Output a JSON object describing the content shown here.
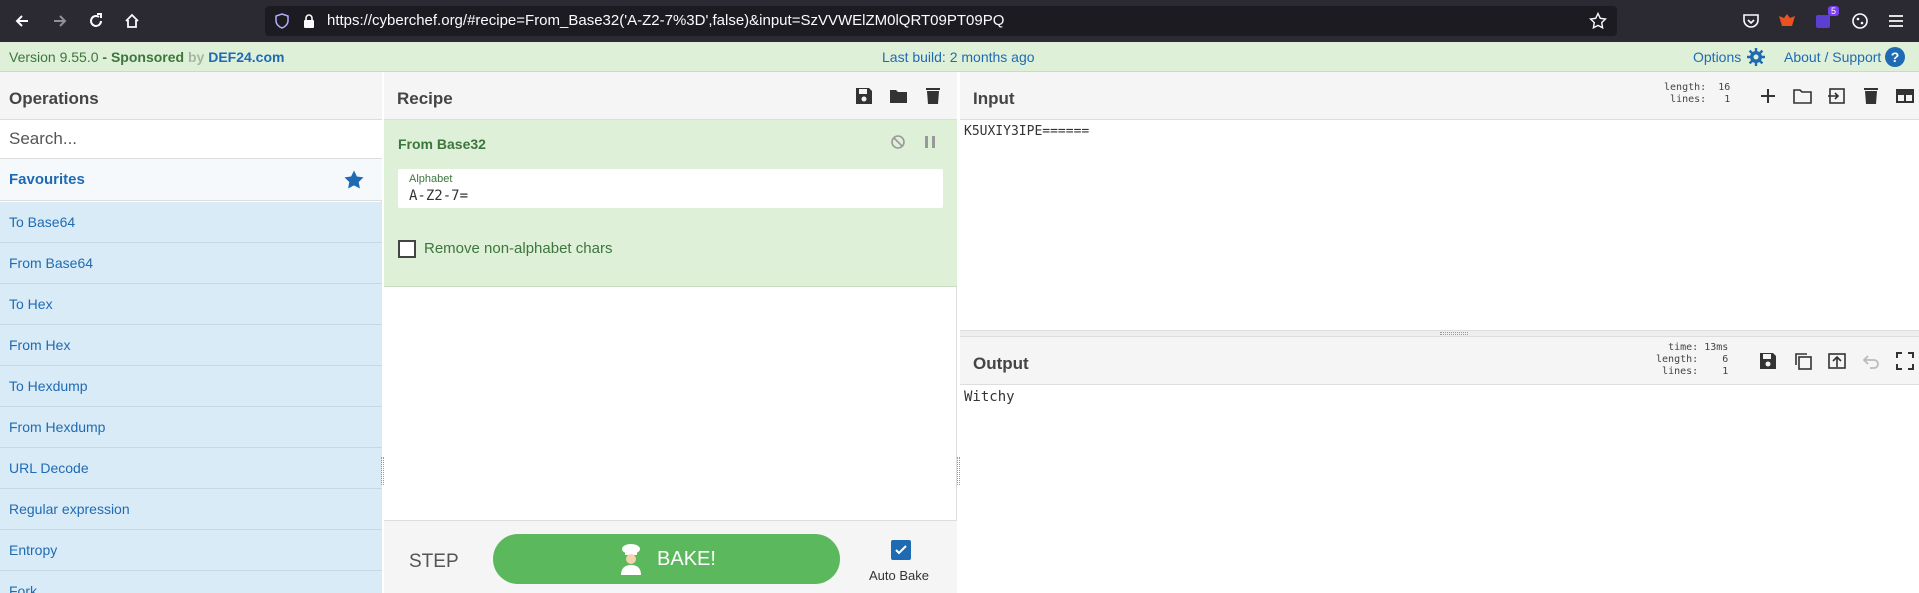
{
  "browser": {
    "url": "https://cyberchef.org/#recipe=From_Base32('A-Z2-7%3D',false)&input=SzVVWElZM0lQRT09PT09PQ",
    "extension_badge": "5"
  },
  "banner": {
    "version": "Version 9.55.0",
    "sponsored_prefix": " - Sponsored",
    "sponsored_by": " by ",
    "sponsor": "DEF24.com",
    "last_build": "Last build: 2 months ago",
    "options": "Options",
    "about": "About / Support",
    "help": "?"
  },
  "operations": {
    "title": "Operations",
    "search_placeholder": "Search...",
    "favourites": "Favourites",
    "items": [
      "To Base64",
      "From Base64",
      "To Hex",
      "From Hex",
      "To Hexdump",
      "From Hexdump",
      "URL Decode",
      "Regular expression",
      "Entropy",
      "Fork"
    ]
  },
  "recipe": {
    "title": "Recipe",
    "op_name": "From Base32",
    "alphabet_label": "Alphabet",
    "alphabet_value": "A-Z2-7=",
    "checkbox_label": "Remove non-alphabet chars",
    "step": "STEP",
    "bake": "BAKE!",
    "auto_bake": "Auto Bake"
  },
  "input": {
    "title": "Input",
    "length_label": "length:",
    "length": "16",
    "lines_label": "lines:",
    "lines": "1",
    "text": "K5UXIY3IPE======"
  },
  "output": {
    "title": "Output",
    "time_label": "time:",
    "time": "13ms",
    "length_label": "length:",
    "length": "6",
    "lines_label": "lines:",
    "lines": "1",
    "text": "Witchy"
  },
  "colors": {
    "accent_blue": "#1f6bb3",
    "recipe_green": "#dff0d8",
    "bake_green": "#5cb85c",
    "ops_item_bg": "#d9ebf6"
  }
}
